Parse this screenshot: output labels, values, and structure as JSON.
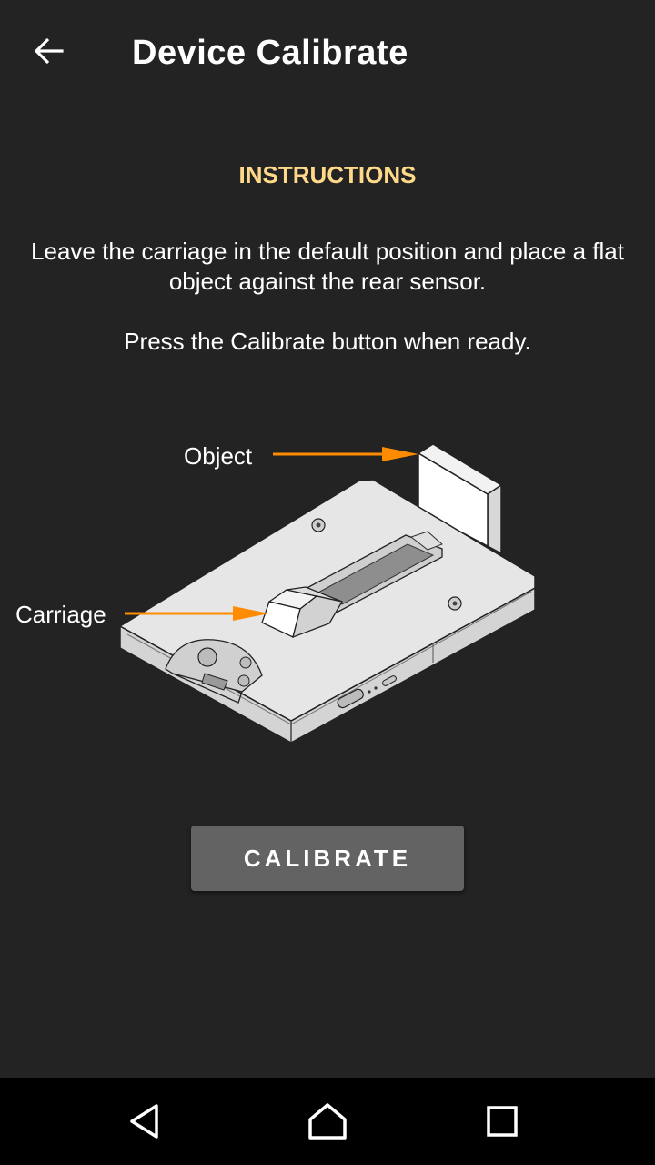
{
  "appbar": {
    "title": "Device Calibrate",
    "back_icon": "arrow-left-icon"
  },
  "instructions": {
    "heading": "INSTRUCTIONS",
    "paragraph_1": "Leave the carriage in the default position and place a flat object against the rear sensor.",
    "paragraph_2": "Press the Calibrate button when ready."
  },
  "illustration": {
    "object_label": "Object",
    "carriage_label": "Carriage",
    "arrow_color": "#ff8c00"
  },
  "actions": {
    "calibrate_label": "CALIBRATE"
  },
  "navbar": {
    "back_icon": "triangle-back-icon",
    "home_icon": "home-icon",
    "recents_icon": "square-recents-icon"
  },
  "colors": {
    "background": "#232323",
    "heading_accent": "#ffd98a",
    "button": "#636363"
  }
}
